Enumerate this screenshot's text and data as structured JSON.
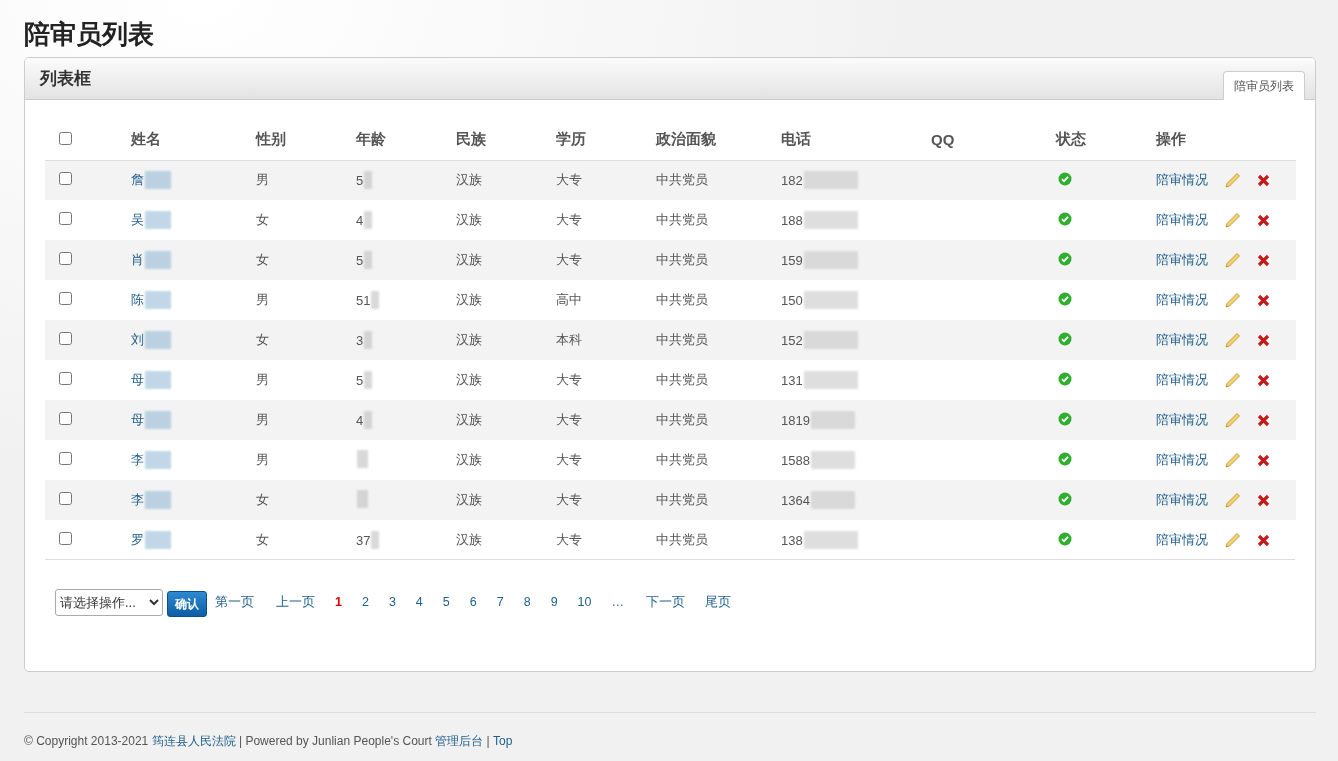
{
  "page_title": "陪审员列表",
  "panel": {
    "title": "列表框",
    "tab": {
      "label": "陪审员列表",
      "selected": true
    }
  },
  "table": {
    "columns": [
      "姓名",
      "性别",
      "年龄",
      "民族",
      "学历",
      "政治面貌",
      "电话",
      "QQ",
      "状态",
      "操作"
    ],
    "select_all_checked": false,
    "rows": [
      {
        "checked": false,
        "name": "詹",
        "gender": "男",
        "age": "5",
        "ethnicity": "汉族",
        "education": "大专",
        "politics": "中共党员",
        "phone": "182",
        "active": true,
        "action": "陪审情况"
      },
      {
        "checked": false,
        "name": "吴",
        "gender": "女",
        "age": "4",
        "ethnicity": "汉族",
        "education": "大专",
        "politics": "中共党员",
        "phone": "188",
        "active": true,
        "action": "陪审情况"
      },
      {
        "checked": false,
        "name": "肖",
        "gender": "女",
        "age": "5",
        "ethnicity": "汉族",
        "education": "大专",
        "politics": "中共党员",
        "phone": "159",
        "active": true,
        "action": "陪审情况"
      },
      {
        "checked": false,
        "name": "陈",
        "gender": "男",
        "age": "51",
        "ethnicity": "汉族",
        "education": "高中",
        "politics": "中共党员",
        "phone": "150",
        "active": true,
        "action": "陪审情况"
      },
      {
        "checked": false,
        "name": "刘",
        "gender": "女",
        "age": "3",
        "ethnicity": "汉族",
        "education": "本科",
        "politics": "中共党员",
        "phone": "152",
        "active": true,
        "action": "陪审情况"
      },
      {
        "checked": false,
        "name": "母",
        "gender": "男",
        "age": "5",
        "ethnicity": "汉族",
        "education": "大专",
        "politics": "中共党员",
        "phone": "131",
        "active": true,
        "action": "陪审情况"
      },
      {
        "checked": false,
        "name": "母",
        "gender": "男",
        "age": "4",
        "ethnicity": "汉族",
        "education": "大专",
        "politics": "中共党员",
        "phone": "1819",
        "active": true,
        "action": "陪审情况"
      },
      {
        "checked": false,
        "name": "李",
        "gender": "男",
        "ethnicity": "汉族",
        "education": "大专",
        "politics": "中共党员",
        "phone": "1588",
        "active": true,
        "action": "陪审情况"
      },
      {
        "checked": false,
        "name": "李",
        "gender": "女",
        "ethnicity": "汉族",
        "education": "大专",
        "politics": "中共党员",
        "phone": "1364",
        "active": true,
        "action": "陪审情况"
      },
      {
        "checked": false,
        "name": "罗",
        "gender": "女",
        "age": "37",
        "ethnicity": "汉族",
        "education": "大专",
        "politics": "中共党员",
        "phone": "138",
        "active": true,
        "action": "陪审情况"
      }
    ]
  },
  "bulk_action": {
    "select": "请选择操作...",
    "button": "确认"
  },
  "pagination": [
    {
      "label": "第一页",
      "selected": false
    },
    {
      "label": "上一页",
      "selected": false
    },
    {
      "label": "1",
      "selected": true
    },
    {
      "label": "2",
      "selected": false
    },
    {
      "label": "3",
      "selected": false
    },
    {
      "label": "4",
      "selected": false
    },
    {
      "label": "5",
      "selected": false
    },
    {
      "label": "6",
      "selected": false
    },
    {
      "label": "7",
      "selected": false
    },
    {
      "label": "8",
      "selected": false
    },
    {
      "label": "9",
      "selected": false
    },
    {
      "label": "10",
      "selected": false
    },
    {
      "label": "…",
      "selected": false
    },
    {
      "label": "下一页",
      "selected": false
    },
    {
      "label": "尾页",
      "selected": false
    }
  ],
  "footer": {
    "copyright": "© Copyright 2013-2021",
    "court_link": "筠连县人民法院",
    "powered": "| Powered by Junlian People's Court",
    "admin_link": "管理后台",
    "separator": "|",
    "top_link": "Top"
  }
}
